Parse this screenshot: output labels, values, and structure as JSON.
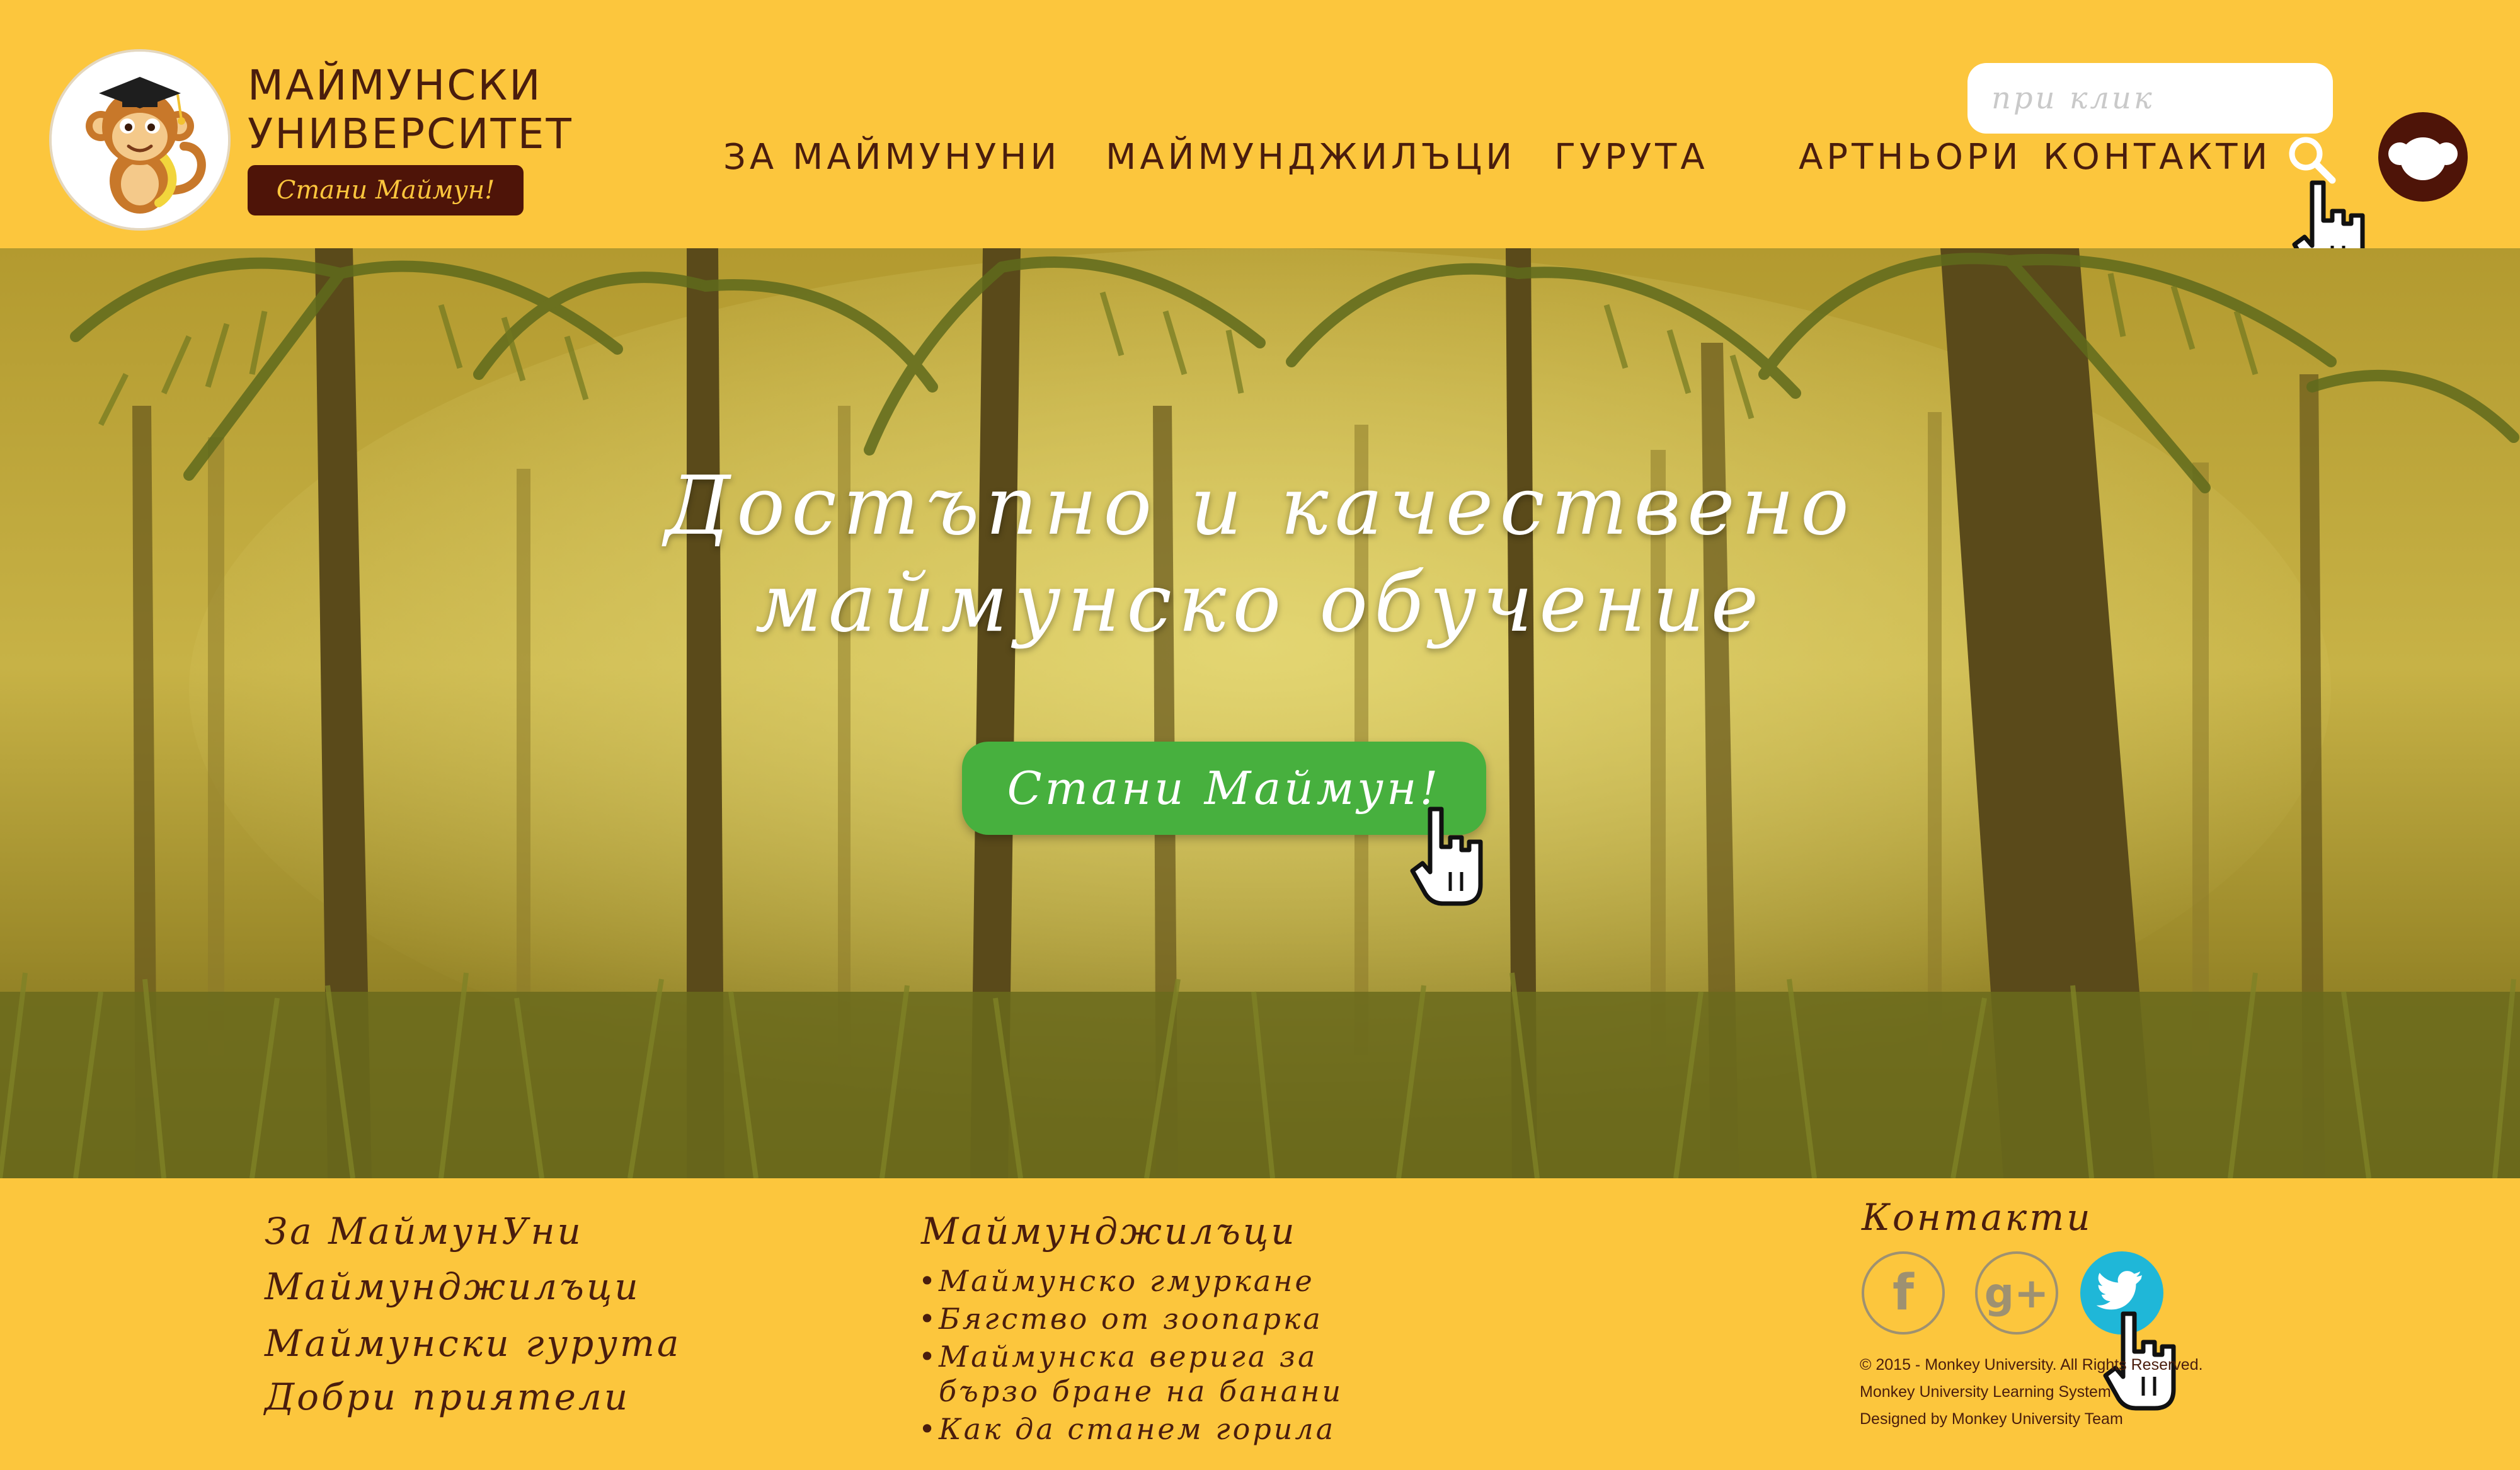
{
  "brand": {
    "line1": "МАЙМУНСКИ",
    "line2": "УНИВЕРСИТЕТ",
    "button_label": "Стани Маймун!"
  },
  "nav": {
    "items": [
      {
        "label": "ЗА МАЙМУНУНИ"
      },
      {
        "label": "МАЙМУНДЖИЛЪЦИ"
      },
      {
        "label": "ГУРУТА"
      },
      {
        "label": "АРТНЬОРИ"
      },
      {
        "label": "КОНТАКТИ"
      }
    ]
  },
  "search": {
    "placeholder": "при клик",
    "icon": "search-icon"
  },
  "hero": {
    "title_line1": "Достъпно и качествено",
    "title_line2": "маймунско обучение",
    "cta_label": "Стани Маймун!"
  },
  "footer": {
    "links": [
      {
        "label": "За МаймунУни"
      },
      {
        "label": "Маймунджилъци"
      },
      {
        "label": "Маймунски гурута"
      },
      {
        "label": "Добри приятели"
      }
    ],
    "column2": {
      "heading": "Маймунджилъци",
      "items": [
        {
          "label": "Маймунско гмуркане"
        },
        {
          "label": "Бягство от зоопарка"
        },
        {
          "label": "Маймунска верига за",
          "label_cont": "бързо бране на банани"
        },
        {
          "label": "Как да станем горила"
        }
      ]
    },
    "contacts": {
      "heading": "Контакти",
      "social": [
        "facebook-icon",
        "google-plus-icon",
        "twitter-icon"
      ],
      "legal_line1": "© 2015 - Monkey University. All Rights Reserved.",
      "legal_line2": "Monkey University Learning System",
      "legal_line3": "Designed by Monkey University Team"
    }
  },
  "colors": {
    "background": "#fcc63d",
    "text_dark": "#4a1d0d",
    "brand_button": "#4e1408",
    "cta_green": "#47b03e",
    "twitter": "#1fb7d8"
  }
}
